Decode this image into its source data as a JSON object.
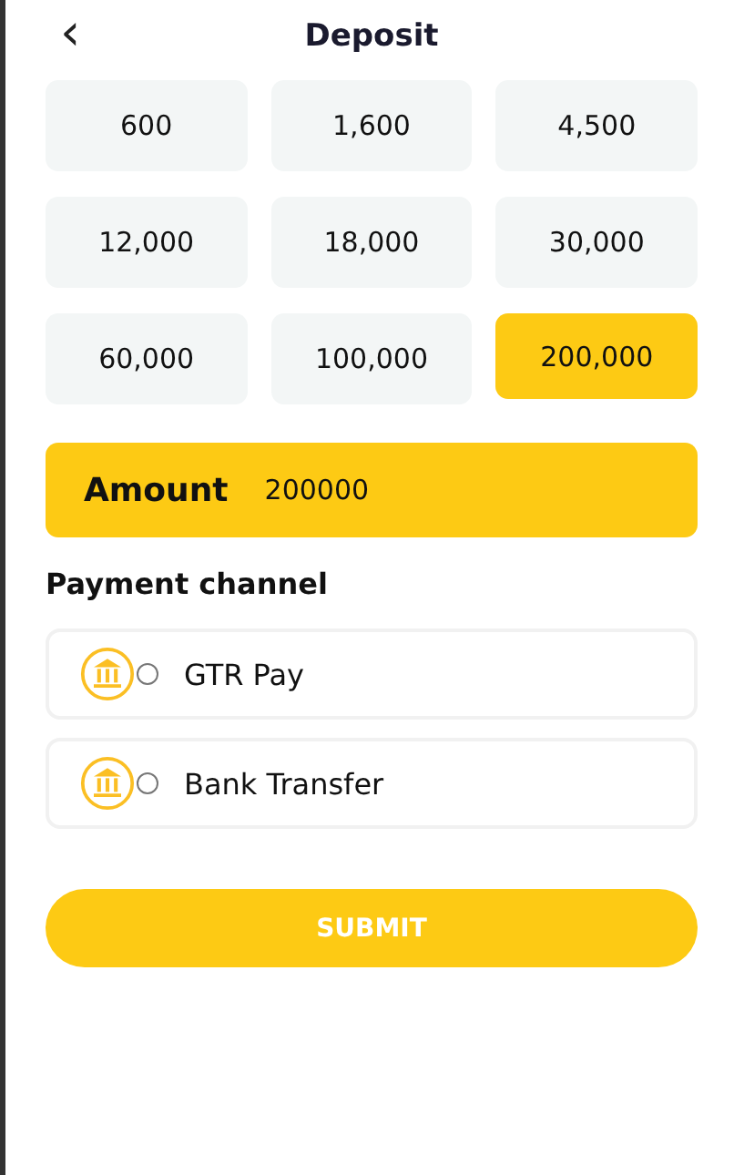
{
  "header": {
    "back_icon": "‹",
    "title": "Deposit"
  },
  "amounts": [
    {
      "label": "600",
      "selected": false
    },
    {
      "label": "1,600",
      "selected": false
    },
    {
      "label": "4,500",
      "selected": false
    },
    {
      "label": "12,000",
      "selected": false
    },
    {
      "label": "18,000",
      "selected": false
    },
    {
      "label": "30,000",
      "selected": false
    },
    {
      "label": "60,000",
      "selected": false
    },
    {
      "label": "100,000",
      "selected": false
    },
    {
      "label": "200,000",
      "selected": true
    }
  ],
  "amount_field": {
    "label": "Amount",
    "value": "200000"
  },
  "payment_channel": {
    "heading": "Payment channel",
    "channels": [
      {
        "name": "GTR Pay",
        "selected": false
      },
      {
        "name": "Bank Transfer",
        "selected": false
      }
    ]
  },
  "submit": "SUBMIT"
}
